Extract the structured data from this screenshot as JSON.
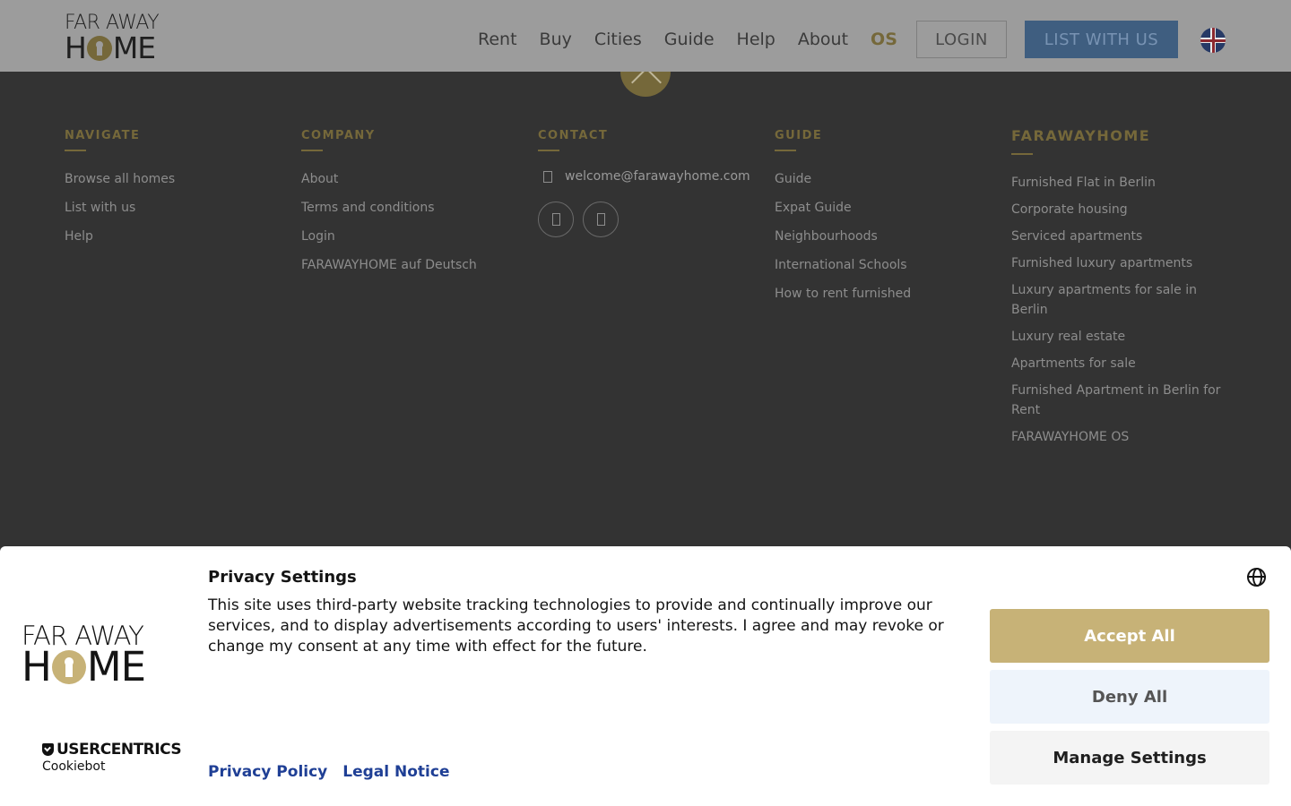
{
  "header": {
    "logo": {
      "line1": "FAR AWAY",
      "line2_left": "H",
      "line2_right": "ME"
    },
    "nav": [
      "Rent",
      "Buy",
      "Cities",
      "Guide",
      "Help",
      "About",
      "OS"
    ],
    "login_label": "LOGIN",
    "list_label": "LIST WITH US",
    "language_icon": "uk-flag-icon"
  },
  "footer": {
    "navigate": {
      "title": "NAVIGATE",
      "links": [
        "Browse all homes",
        "List with us",
        "Help"
      ]
    },
    "company": {
      "title": "COMPANY",
      "links": [
        "About",
        "Terms and conditions",
        "Login",
        "FARAWAYHOME auf Deutsch"
      ]
    },
    "contact": {
      "title": "CONTACT",
      "email": "welcome@farawayhome.com",
      "social_icons": [
        "social-icon-1",
        "social-icon-2"
      ]
    },
    "guide": {
      "title": "GUIDE",
      "links": [
        "Guide",
        "Expat Guide",
        "Neighbourhoods",
        "International Schools",
        "How to rent furnished"
      ]
    },
    "farawayhome": {
      "title": "FARAWAYHOME",
      "links": [
        "Furnished Flat in Berlin",
        "Corporate housing",
        "Serviced apartments",
        "Furnished luxury apartments",
        "Luxury apartments for sale in Berlin",
        "Luxury real estate",
        "Apartments for sale",
        "Furnished Apartment in Berlin for Rent",
        "FARAWAYHOME OS"
      ]
    }
  },
  "cookie": {
    "logo": {
      "line1": "FAR AWAY",
      "line2_left": "H",
      "line2_right": "ME"
    },
    "provider": "USERCENTRICS",
    "provider_sub": "Cookiebot",
    "title": "Privacy Settings",
    "text": "This site uses third-party website tracking technologies to provide and continually improve our services, and to display advertisements according to users' interests. I agree and may revoke or change my consent at any time with effect for the future.",
    "links": [
      "Privacy Policy",
      "Legal Notice"
    ],
    "accept_label": "Accept All",
    "deny_label": "Deny All",
    "manage_label": "Manage Settings"
  },
  "colors": {
    "gold": "#c7b277",
    "link_blue": "#1f3f95",
    "footer_bg": "#333333"
  }
}
